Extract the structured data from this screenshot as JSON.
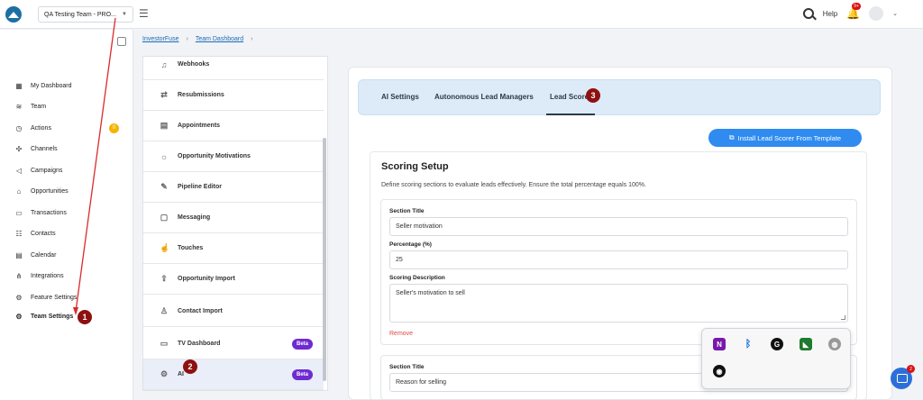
{
  "topbar": {
    "team_select": "QA Testing Team - PRO...",
    "help": "Help",
    "notif_count": "9+"
  },
  "sidebar": {
    "items": [
      {
        "label": "My Dashboard",
        "icon": "grid-icon"
      },
      {
        "label": "Team",
        "icon": "layers-icon"
      },
      {
        "label": "Actions",
        "icon": "check-circle-icon",
        "count": "0"
      },
      {
        "label": "Channels",
        "icon": "puzzle-icon"
      },
      {
        "label": "Campaigns",
        "icon": "megaphone-icon"
      },
      {
        "label": "Opportunities",
        "icon": "home-icon"
      },
      {
        "label": "Transactions",
        "icon": "card-icon"
      },
      {
        "label": "Contacts",
        "icon": "users-icon"
      },
      {
        "label": "Calendar",
        "icon": "calendar-icon"
      },
      {
        "label": "Integrations",
        "icon": "network-icon"
      },
      {
        "label": "Feature Settings",
        "icon": "sliders-icon"
      },
      {
        "label": "Team Settings",
        "icon": "gear-icon"
      }
    ]
  },
  "breadcrumb": {
    "items": [
      "InvestorFuse",
      "Team Dashboard"
    ]
  },
  "settings_list": {
    "items": [
      {
        "label": "Webhooks",
        "icon": "bell-icon"
      },
      {
        "label": "Resubmissions",
        "icon": "arrows-icon"
      },
      {
        "label": "Appointments",
        "icon": "calendar-icon"
      },
      {
        "label": "Opportunity Motivations",
        "icon": "bulb-icon"
      },
      {
        "label": "Pipeline Editor",
        "icon": "edit-icon"
      },
      {
        "label": "Messaging",
        "icon": "chat-icon"
      },
      {
        "label": "Touches",
        "icon": "hand-icon"
      },
      {
        "label": "Opportunity Import",
        "icon": "upload-icon"
      },
      {
        "label": "Contact Import",
        "icon": "user-plus-icon"
      },
      {
        "label": "TV Dashboard",
        "icon": "tv-icon",
        "badge": "Beta"
      },
      {
        "label": "AI",
        "icon": "ai-icon",
        "badge": "Beta"
      }
    ]
  },
  "tabs": [
    "AI Settings",
    "Autonomous Lead Managers",
    "Lead Scorer"
  ],
  "install_button": "Install Lead Scorer From Template",
  "scoring": {
    "title": "Scoring Setup",
    "description": "Define scoring sections to evaluate leads effectively. Ensure the total percentage equals 100%.",
    "section_title_label": "Section Title",
    "percentage_label": "Percentage (%)",
    "description_label": "Scoring Description",
    "sections": [
      {
        "title": "Seller motivation",
        "percentage": "25",
        "description": "Seller's motivation to sell"
      },
      {
        "title": "Reason for selling"
      }
    ],
    "remove_label": "Remove"
  },
  "annotations": [
    "1",
    "2",
    "3"
  ],
  "chat_badge": "2",
  "colors": {
    "primary": "#2f8bf0",
    "beta": "#6f2bd1",
    "marker": "#8e1010",
    "remove": "#e04848"
  }
}
